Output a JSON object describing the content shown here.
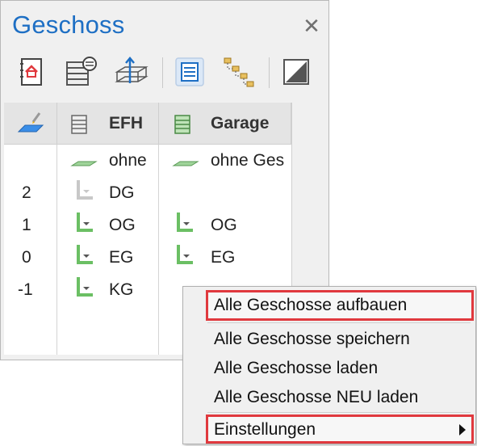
{
  "panel": {
    "title": "Geschoss",
    "close_symbol": "✕"
  },
  "toolbar": {
    "buttons": [
      {
        "name": "house-book-icon"
      },
      {
        "name": "floor-settings-icon"
      },
      {
        "name": "floor-height-icon"
      },
      {
        "name": "list-view-icon"
      },
      {
        "name": "tree-structure-icon"
      },
      {
        "name": "section-view-icon"
      }
    ]
  },
  "table": {
    "columns": [
      {
        "label": ""
      },
      {
        "label": "EFH"
      },
      {
        "label": "Garage"
      }
    ],
    "level_numbers": [
      "2",
      "1",
      "0",
      "-1"
    ],
    "efh_items": [
      "ohne",
      "DG",
      "OG",
      "EG",
      "KG"
    ],
    "garage_items": [
      "ohne Ges",
      "OG",
      "EG"
    ]
  },
  "context_menu": {
    "items": [
      "Alle Geschosse aufbauen",
      "Alle Geschosse speichern",
      "Alle Geschosse laden",
      "Alle Geschosse NEU laden",
      "Einstellungen"
    ]
  },
  "colors": {
    "title": "#1e6fc4",
    "highlight_border": "#e0393e",
    "floor_green": "#7ec47a",
    "plane_blue": "#3a8ee8"
  }
}
